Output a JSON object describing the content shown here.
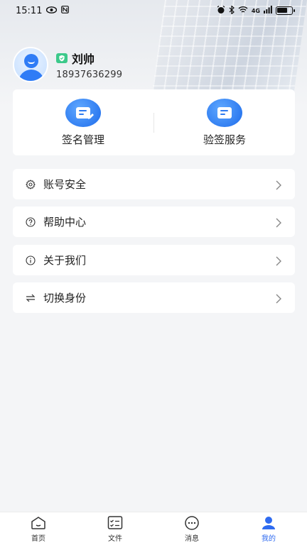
{
  "status_bar": {
    "time": "15:11",
    "network": "4G"
  },
  "profile": {
    "name": "刘帅",
    "phone": "18937636299",
    "verified_icon": "shield-check-icon"
  },
  "services": [
    {
      "label": "签名管理",
      "icon": "sign-document-icon"
    },
    {
      "label": "验签服务",
      "icon": "verify-document-icon"
    }
  ],
  "menu": [
    {
      "label": "账号安全",
      "icon": "gear-icon"
    },
    {
      "label": "帮助中心",
      "icon": "question-circle-icon"
    },
    {
      "label": "关于我们",
      "icon": "info-circle-icon"
    },
    {
      "label": "切换身份",
      "icon": "swap-arrows-icon"
    }
  ],
  "bottom_nav": [
    {
      "label": "首页",
      "icon": "home-icon",
      "active": false
    },
    {
      "label": "文件",
      "icon": "file-checklist-icon",
      "active": false
    },
    {
      "label": "消息",
      "icon": "message-dots-icon",
      "active": false
    },
    {
      "label": "我的",
      "icon": "user-icon",
      "active": true
    }
  ],
  "colors": {
    "accent": "#2f6bf0",
    "background": "#f4f5f7",
    "card": "#ffffff",
    "verified": "#3cc98a"
  }
}
